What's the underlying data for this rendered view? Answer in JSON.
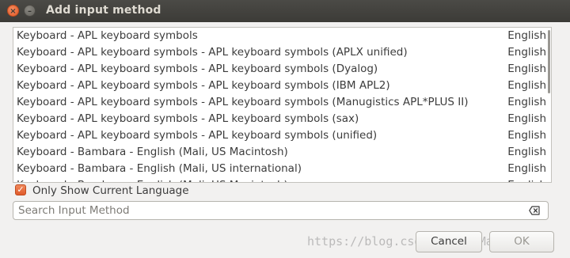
{
  "window": {
    "title": "Add input method",
    "close_glyph": "×",
    "minimize_glyph": "–"
  },
  "list": {
    "items": [
      {
        "name": "Keyboard - APL keyboard symbols",
        "language": "English"
      },
      {
        "name": "Keyboard - APL keyboard symbols - APL keyboard symbols (APLX unified)",
        "language": "English"
      },
      {
        "name": "Keyboard - APL keyboard symbols - APL keyboard symbols (Dyalog)",
        "language": "English"
      },
      {
        "name": "Keyboard - APL keyboard symbols - APL keyboard symbols (IBM APL2)",
        "language": "English"
      },
      {
        "name": "Keyboard - APL keyboard symbols - APL keyboard symbols (Manugistics APL*PLUS II)",
        "language": "English"
      },
      {
        "name": "Keyboard - APL keyboard symbols - APL keyboard symbols (sax)",
        "language": "English"
      },
      {
        "name": "Keyboard - APL keyboard symbols - APL keyboard symbols (unified)",
        "language": "English"
      },
      {
        "name": "Keyboard - Bambara - English (Mali, US Macintosh)",
        "language": "English"
      },
      {
        "name": "Keyboard - Bambara - English (Mali, US international)",
        "language": "English"
      },
      {
        "name": "Keyboard - Bambara - English (Mali, US Macintosh)",
        "language": "English"
      }
    ]
  },
  "filter": {
    "checked": true,
    "check_glyph": "✓",
    "label": "Only Show Current Language"
  },
  "search": {
    "placeholder": "Search Input Method",
    "value": "",
    "clear_icon": "backspace-icon"
  },
  "buttons": {
    "cancel_label": "Cancel",
    "ok_label": "OK"
  },
  "watermark": {
    "text": "https://blog.csdn.net/FIMarkigal"
  },
  "colors": {
    "accent": "#e05a2a",
    "titlebar": "#3c3b37",
    "background": "#f2f1f0"
  }
}
